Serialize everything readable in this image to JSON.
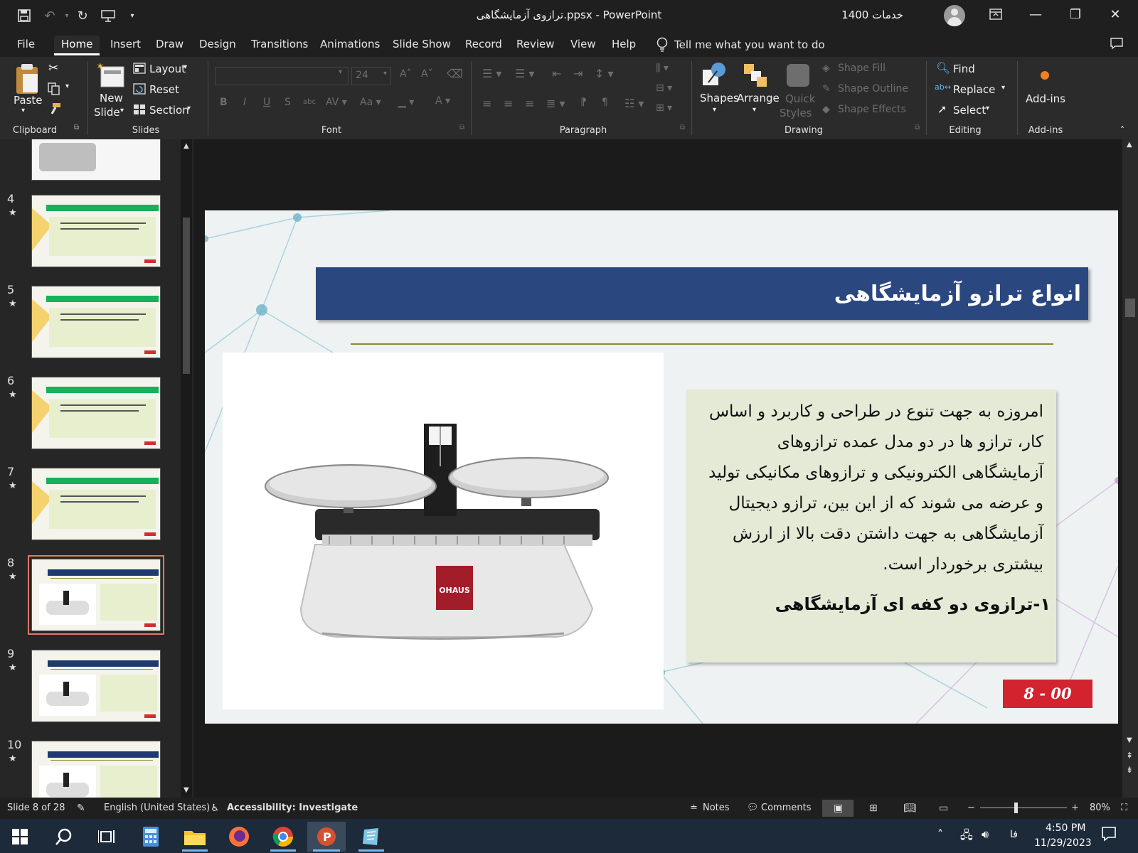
{
  "window": {
    "title": "ترازوی آزمایشگاهی.ppsx  -  PowerPoint",
    "user_name": "خدمات 1400"
  },
  "menu": {
    "tabs": [
      "File",
      "Home",
      "Insert",
      "Draw",
      "Design",
      "Transitions",
      "Animations",
      "Slide Show",
      "Record",
      "Review",
      "View",
      "Help"
    ],
    "active_tab": "Home",
    "tell_me": "Tell me what you want to do"
  },
  "ribbon": {
    "clipboard": {
      "paste": "Paste",
      "label": "Clipboard"
    },
    "slides": {
      "new_slide_line1": "New",
      "new_slide_line2": "Slide",
      "layout": "Layout",
      "reset": "Reset",
      "section": "Section",
      "label": "Slides"
    },
    "font": {
      "size": "24",
      "label": "Font"
    },
    "paragraph": {
      "label": "Paragraph"
    },
    "drawing": {
      "shapes": "Shapes",
      "arrange": "Arrange",
      "quick_styles_1": "Quick",
      "quick_styles_2": "Styles",
      "shape_fill": "Shape Fill",
      "shape_outline": "Shape Outline",
      "shape_effects": "Shape Effects",
      "label": "Drawing"
    },
    "editing": {
      "find": "Find",
      "replace": "Replace",
      "select": "Select",
      "label": "Editing"
    },
    "addins": {
      "button": "Add-ins",
      "label": "Add-ins"
    }
  },
  "thumbnails": [
    {
      "num": "4",
      "star": "★",
      "style": "green"
    },
    {
      "num": "5",
      "star": "★",
      "style": "green"
    },
    {
      "num": "6",
      "star": "★",
      "style": "green"
    },
    {
      "num": "7",
      "star": "★",
      "style": "green"
    },
    {
      "num": "8",
      "star": "★",
      "style": "blue",
      "selected": true
    },
    {
      "num": "9",
      "star": "★",
      "style": "blue"
    },
    {
      "num": "10",
      "star": "★",
      "style": "blue"
    }
  ],
  "slide": {
    "title": "انواع ترازو آزمایشگاهی",
    "paragraph": "امروزه به جهت تنوع در طراحی و کاربرد و اساس کار، ترازو ها در دو مدل عمده ترازوهای آزمایشگاهی الکترونیکی و ترازوهای مکانیکی تولید و عرضه می شوند که از این بین، ترازو دیجیتال آزمایشگاهی به جهت داشتن دقت بالا از ارزش بیشتری برخوردار است.",
    "subheading": "۱-ترازوی دو کفه ای آزمایشگاهی",
    "scale_brand": "OHAUS",
    "number_badge": "8  -  00"
  },
  "status": {
    "slide_of": "Slide 8 of 28",
    "language": "English (United States)",
    "accessibility": "Accessibility: Investigate",
    "notes": "Notes",
    "comments": "Comments",
    "zoom": "80%"
  },
  "taskbar": {
    "lang": "فا",
    "time": "4:50 PM",
    "date": "11/29/2023"
  },
  "colors": {
    "slide_title_bg": "#2b4780",
    "text_box_bg": "#e4ead6",
    "badge_red": "#d3232f",
    "thumb_green": "#17b05b"
  }
}
